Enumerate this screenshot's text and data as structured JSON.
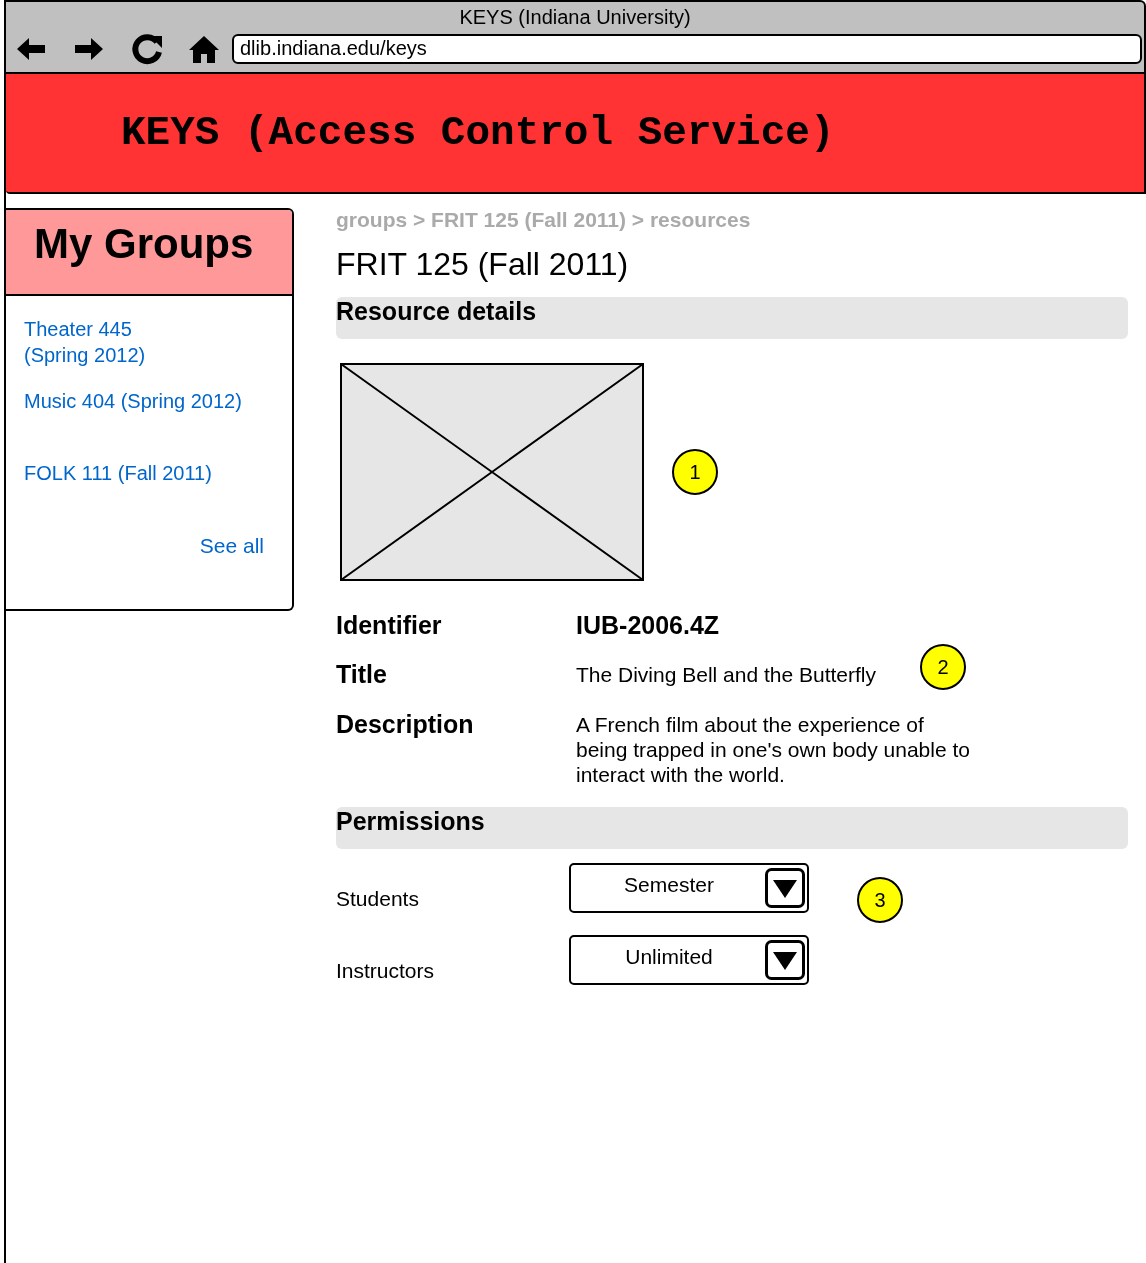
{
  "window": {
    "title": "KEYS (Indiana University)"
  },
  "address_bar": {
    "value": "dlib.indiana.edu/keys"
  },
  "header": {
    "title": "KEYS (Access Control Service)"
  },
  "sidebar": {
    "title": "My Groups",
    "items": [
      {
        "label": "Theater 445\n(Spring 2012)"
      },
      {
        "label": "Music 404 (Spring 2012)"
      },
      {
        "label": "FOLK 111 (Fall 2011)"
      }
    ],
    "see_all": "See all"
  },
  "breadcrumb": "groups > FRIT 125 (Fall 2011) > resources",
  "page_title": "FRIT 125 (Fall 2011)",
  "resource_details": {
    "heading": "Resource details",
    "callout": "1"
  },
  "fields": [
    {
      "label": "Identifier",
      "value": "IUB-2006.4Z",
      "kind": "code"
    },
    {
      "label": "Title",
      "value": "The Diving Bell and the Butterfly",
      "kind": "text",
      "callout": "2"
    },
    {
      "label": "Description",
      "value": "A French film about the experience of being trapped in one's own body unable to interact with the world.",
      "kind": "text"
    }
  ],
  "permissions": {
    "heading": "Permissions",
    "callout": "3",
    "rows": [
      {
        "label": "Students",
        "value": "Semester"
      },
      {
        "label": "Instructors",
        "value": "Unlimited"
      }
    ]
  }
}
